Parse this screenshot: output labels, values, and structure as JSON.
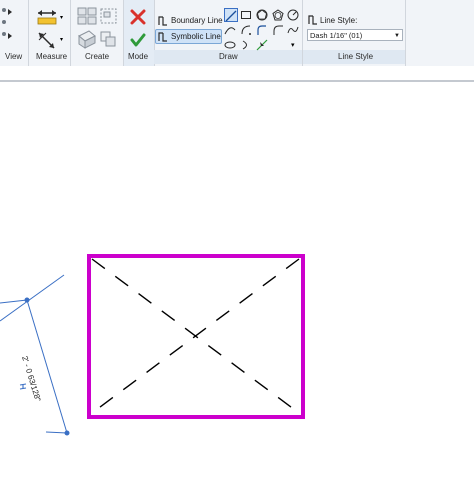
{
  "ribbon": {
    "panels": {
      "view": "View",
      "measure": "Measure",
      "create": "Create",
      "mode": "Mode",
      "draw": "Draw",
      "line_style": "Line Style"
    },
    "draw": {
      "boundary_line": "Boundary Line",
      "symbolic_line": "Symbolic Line"
    },
    "line_style": {
      "label": "Line Style:",
      "value": "Dash 1/16\" (01)"
    }
  },
  "canvas": {
    "dimension_text": "2' - 0 63/128\""
  },
  "colors": {
    "boundary": "#cc00cc",
    "dimension": "#3a6fc4",
    "finish_red": "#d9312b",
    "finish_green": "#2e9a3a"
  }
}
